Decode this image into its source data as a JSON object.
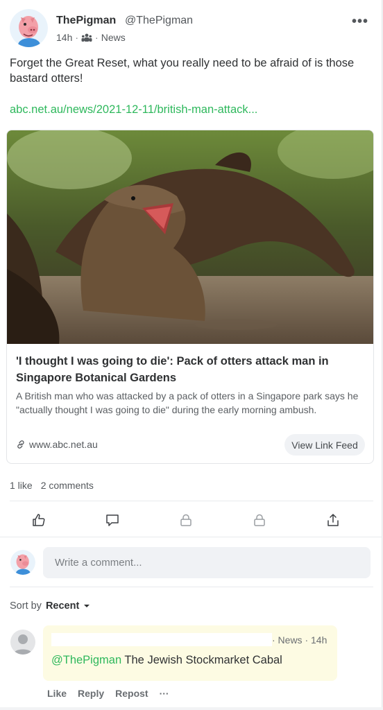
{
  "post": {
    "author_name": "ThePigman",
    "author_handle": "@ThePigman",
    "time": "14h",
    "audience_icon": "group-icon",
    "group": "News",
    "text": "Forget the Great Reset, what you really need to be afraid of is those bastard otters!",
    "link_url": "abc.net.au/news/2021-12-11/british-man-attack..."
  },
  "link_preview": {
    "title": "'I thought I was going to die': Pack of otters attack man in Singapore Botanical Gardens",
    "description": "A British man who was attacked by a pack of otters in a Singapore park says he \"actually thought I was going to die\" during the early morning ambush.",
    "domain": "www.abc.net.au",
    "view_feed_label": "View Link Feed"
  },
  "stats": {
    "likes": "1 like",
    "comments": "2 comments"
  },
  "composer": {
    "placeholder": "Write a comment..."
  },
  "sort": {
    "label": "Sort by",
    "value": "Recent"
  },
  "comment": {
    "meta": "· News · 14h",
    "mention": "@ThePigman",
    "text": " The Jewish Stockmarket Cabal",
    "actions": [
      "Like",
      "Reply",
      "Repost",
      "···"
    ]
  },
  "colors": {
    "accent_green": "#2eb85c",
    "comment_bg": "#fdfbe3"
  }
}
